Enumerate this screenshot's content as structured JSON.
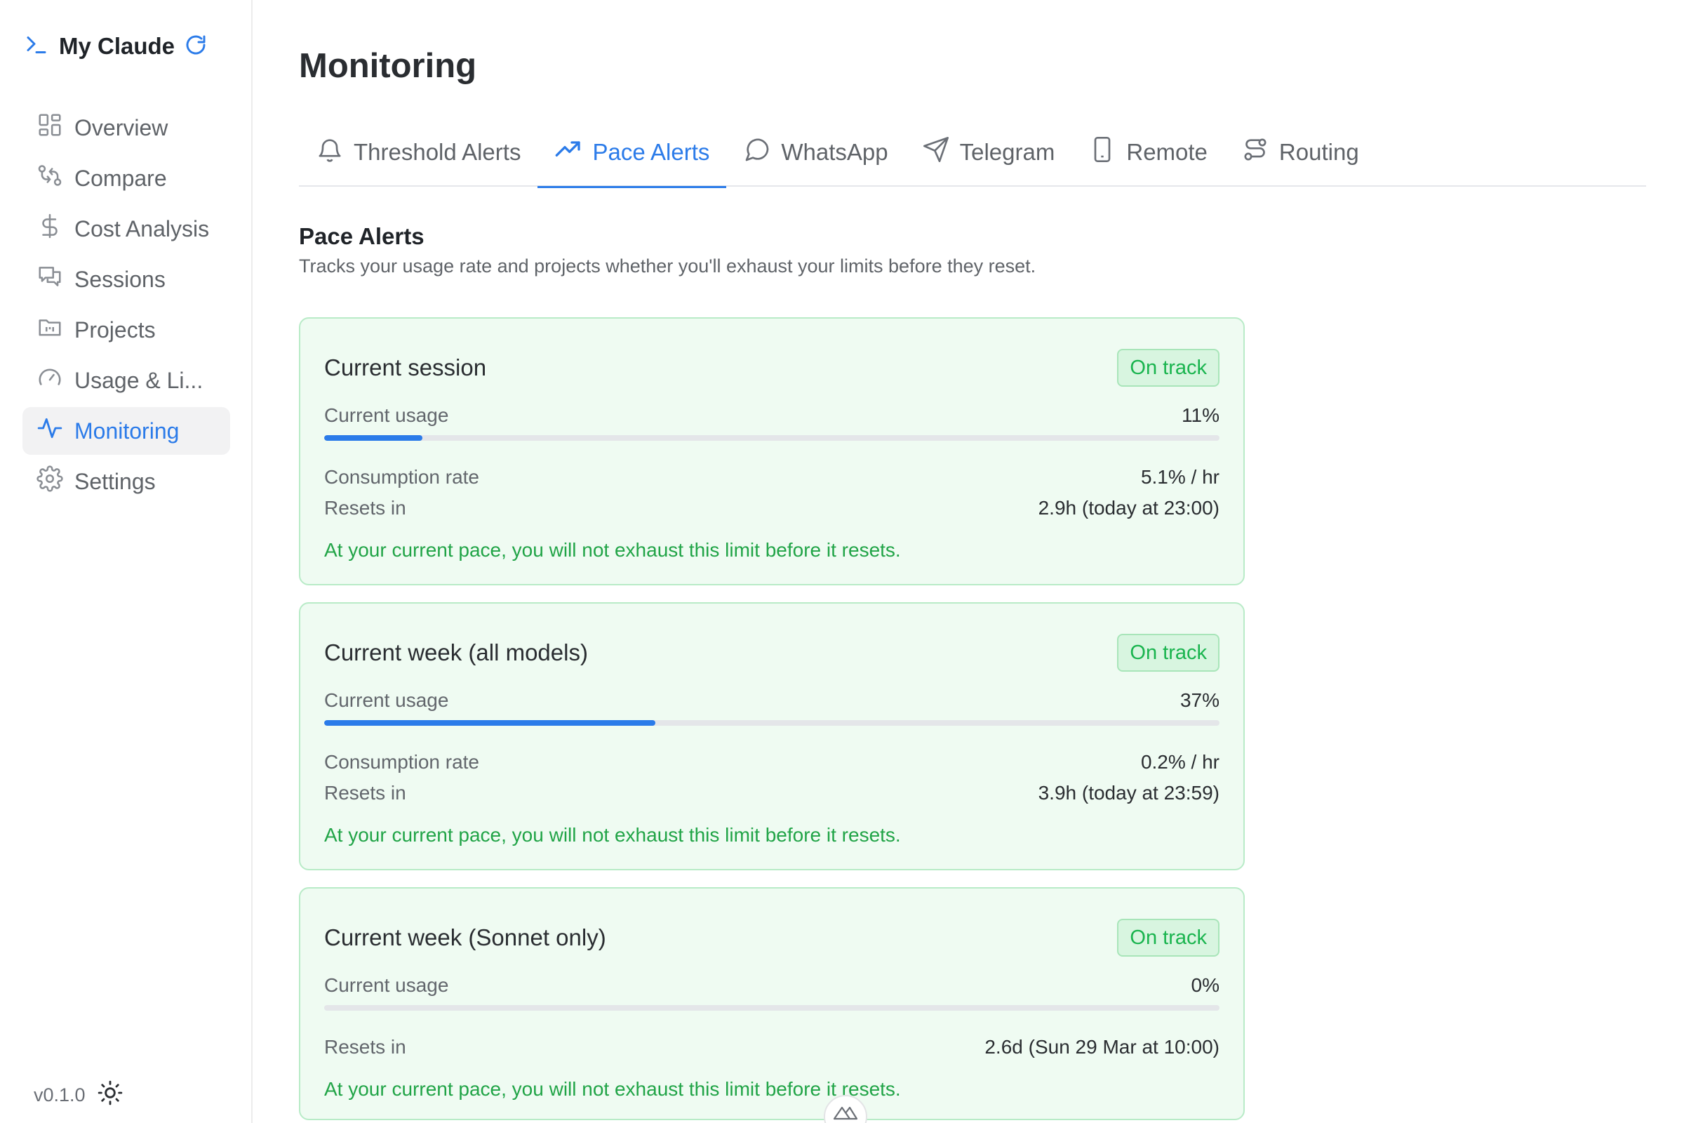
{
  "app": {
    "name": "My Claude",
    "version": "v0.1.0"
  },
  "sidebar": {
    "items": [
      {
        "label": "Overview",
        "icon": "grid-icon"
      },
      {
        "label": "Compare",
        "icon": "compare-icon"
      },
      {
        "label": "Cost Analysis",
        "icon": "dollar-icon"
      },
      {
        "label": "Sessions",
        "icon": "chat-icon"
      },
      {
        "label": "Projects",
        "icon": "folder-icon"
      },
      {
        "label": "Usage & Li...",
        "icon": "gauge-icon"
      },
      {
        "label": "Monitoring",
        "icon": "activity-icon",
        "active": true
      },
      {
        "label": "Settings",
        "icon": "gear-icon"
      }
    ]
  },
  "page": {
    "title": "Monitoring"
  },
  "tabs": [
    {
      "label": "Threshold Alerts",
      "icon": "bell-icon"
    },
    {
      "label": "Pace Alerts",
      "icon": "trending-up-icon",
      "active": true
    },
    {
      "label": "WhatsApp",
      "icon": "message-circle-icon"
    },
    {
      "label": "Telegram",
      "icon": "send-icon"
    },
    {
      "label": "Remote",
      "icon": "phone-icon"
    },
    {
      "label": "Routing",
      "icon": "route-icon"
    }
  ],
  "section": {
    "title": "Pace Alerts",
    "description": "Tracks your usage rate and projects whether you'll exhaust your limits before they reset."
  },
  "cards": [
    {
      "title": "Current session",
      "status": "On track",
      "usage_label": "Current usage",
      "usage_value": "11%",
      "usage_fraction": 0.11,
      "rate_label": "Consumption rate",
      "rate_value": "5.1% / hr",
      "reset_label": "Resets in",
      "reset_value": "2.9h (today at 23:00)",
      "note": "At your current pace, you will not exhaust this limit before it resets."
    },
    {
      "title": "Current week (all models)",
      "status": "On track",
      "usage_label": "Current usage",
      "usage_value": "37%",
      "usage_fraction": 0.37,
      "rate_label": "Consumption rate",
      "rate_value": "0.2% / hr",
      "reset_label": "Resets in",
      "reset_value": "3.9h (today at 23:59)",
      "note": "At your current pace, you will not exhaust this limit before it resets."
    },
    {
      "title": "Current week (Sonnet only)",
      "status": "On track",
      "usage_label": "Current usage",
      "usage_value": "0%",
      "usage_fraction": 0.0,
      "reset_label": "Resets in",
      "reset_value": "2.6d (Sun 29 Mar at 10:00)",
      "note": "At your current pace, you will not exhaust this limit before it resets."
    }
  ],
  "colors": {
    "accent": "#2b7be9",
    "success": "#21a447",
    "card_bg": "#effbf2"
  }
}
